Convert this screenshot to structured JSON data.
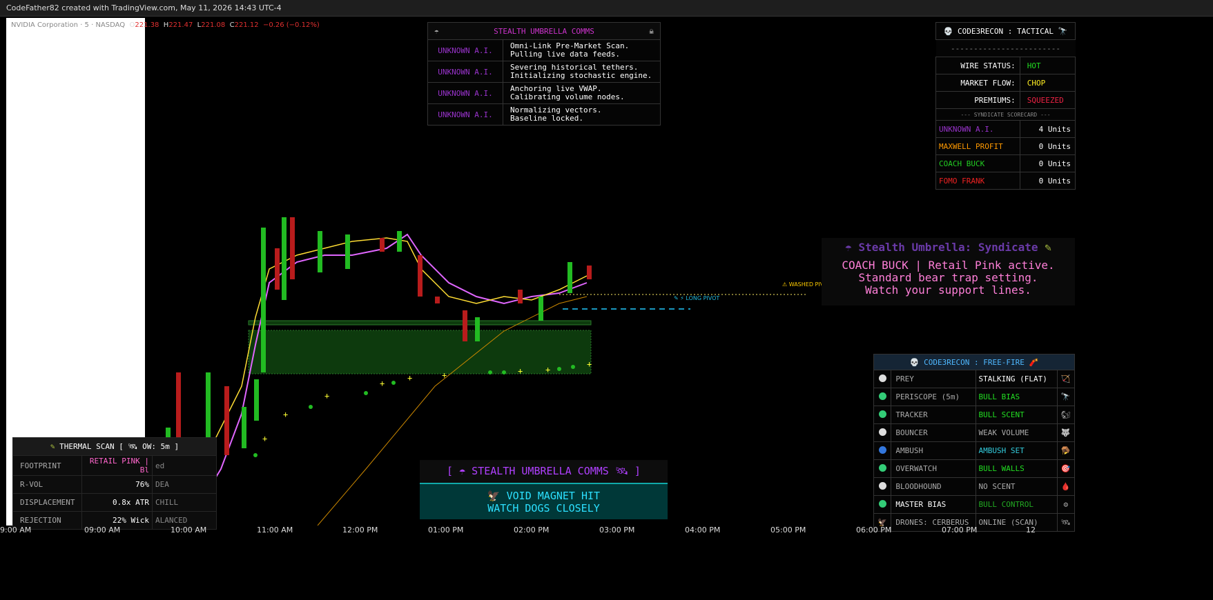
{
  "header": {
    "text": "CodeFather82 created with TradingView.com, May 11, 2026 14:43 UTC-4"
  },
  "symbol": {
    "name": "NVIDIA Corporation · 5 · NASDAQ",
    "o_label": "O",
    "o": "221.38",
    "h_label": "H",
    "h": "221.47",
    "l_label": "L",
    "l": "221.08",
    "c_label": "C",
    "c": "221.12",
    "change": "−0.26 (−0.12%)"
  },
  "comms": {
    "title": "STEALTH UMBRELLA COMMS",
    "rows": [
      {
        "who": "UNKNOWN A.I.",
        "l1": "Omni-Link Pre-Market Scan.",
        "l2": "Pulling live data feeds."
      },
      {
        "who": "UNKNOWN A.I.",
        "l1": "Severing historical tethers.",
        "l2": "Initializing stochastic engine."
      },
      {
        "who": "UNKNOWN A.I.",
        "l1": "Anchoring live VWAP.",
        "l2": "Calibrating volume nodes."
      },
      {
        "who": "UNKNOWN A.I.",
        "l1": "Normalizing vectors.",
        "l2": "Baseline locked."
      }
    ]
  },
  "tactical": {
    "title": "CODE3RECON : TACTICAL",
    "dashes": "------------------------",
    "wire_label": "WIRE STATUS:",
    "wire": "HOT",
    "flow_label": "MARKET FLOW:",
    "flow": "CHOP",
    "prem_label": "PREMIUMS:",
    "prem": "SQUEEZED",
    "scorecard": "--- SYNDICATE SCORECARD ---",
    "scores": [
      {
        "name": "UNKNOWN A.I.",
        "units": "4 Units",
        "color": "#9933cc"
      },
      {
        "name": "MAXWELL PROFIT",
        "units": "0 Units",
        "color": "#ff9900"
      },
      {
        "name": "COACH BUCK",
        "units": "0 Units",
        "color": "#22cc22"
      },
      {
        "name": "FOMO FRANK",
        "units": "0 Units",
        "color": "#ee2222"
      }
    ]
  },
  "syndicate": {
    "title": "Stealth Umbrella: Syndicate",
    "l1": "COACH BUCK | Retail Pink active.",
    "l2": "Standard bear trap setting.",
    "l3": "Watch your support lines."
  },
  "freefire": {
    "title": "CODE3RECON : FREE-FIRE",
    "rows": [
      {
        "name": "PREY",
        "status": "STALKING (FLAT)",
        "dot": "#dddddd",
        "sc": "#ffffff"
      },
      {
        "name": "PERISCOPE (5m)",
        "status": "BULL BIAS",
        "dot": "#33cc77",
        "sc": "#22dd22"
      },
      {
        "name": "TRACKER",
        "status": "BULL SCENT",
        "dot": "#33cc77",
        "sc": "#22dd22"
      },
      {
        "name": "BOUNCER",
        "status": "WEAK VOLUME",
        "dot": "#dddddd",
        "sc": "#aaaaaa"
      },
      {
        "name": "AMBUSH",
        "status": "AMBUSH SET",
        "dot": "#3377dd",
        "sc": "#33ccdd"
      },
      {
        "name": "OVERWATCH",
        "status": "BULL WALLS",
        "dot": "#33cc77",
        "sc": "#22dd22"
      },
      {
        "name": "BLOODHOUND",
        "status": "NO SCENT",
        "dot": "#dddddd",
        "sc": "#aaaaaa"
      },
      {
        "name": "MASTER BIAS",
        "status": "BULL CONTROL",
        "dot": "#33cc77",
        "sc": "#22aa22"
      },
      {
        "name": "DRONES: CERBERUS",
        "status": "ONLINE (SCAN)",
        "dot": "",
        "sc": "#aaaaaa"
      }
    ]
  },
  "thermal": {
    "title": "THERMAL SCAN [",
    "title2": "OW: 5m ]",
    "rows": [
      {
        "name": "FOOTPRINT",
        "val": "RETAIL PINK | Bl",
        "c2": "ed",
        "vc": "#ff66cc"
      },
      {
        "name": "R-VOL",
        "val": "76%",
        "c2": "DEA",
        "vc": "#ffffff"
      },
      {
        "name": "DISPLACEMENT",
        "val": "0.8x ATR",
        "c2": "CHILL",
        "vc": "#ffffff"
      },
      {
        "name": "REJECTION",
        "val": "22% Wick",
        "c2": "ALANCED",
        "vc": "#ffffff"
      }
    ]
  },
  "bottom_comms": {
    "title": "[ ☂ STEALTH UMBRELLA COMMS 🛰 ]",
    "l1": "VOID MAGNET HIT",
    "l2": "WATCH DOGS CLOSELY"
  },
  "pivots": {
    "washed": "WASHED PIVOT",
    "long": "LONG PIVOT"
  },
  "xaxis": [
    "9:00 AM",
    "09:00 AM",
    "10:00 AM",
    "11:00 AM",
    "12:00 PM",
    "01:00 PM",
    "02:00 PM",
    "03:00 PM",
    "04:00 PM",
    "05:00 PM",
    "06:00 PM",
    "07:00 PM",
    "12"
  ]
}
